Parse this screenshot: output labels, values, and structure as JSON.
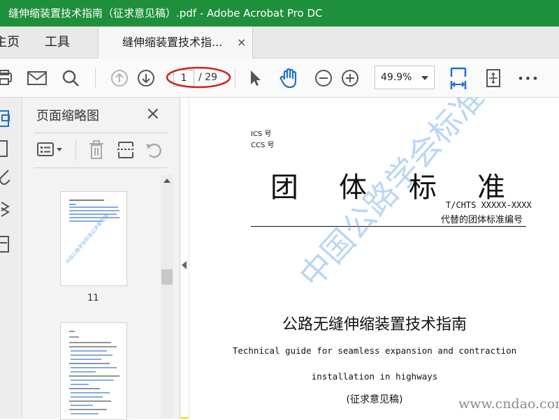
{
  "window": {
    "title": "缝伸缩装置技术指南（征求意见稿）.pdf - Adobe Acrobat Pro DC"
  },
  "nav": {
    "home": "主页",
    "tools": "工具"
  },
  "doc_tab": {
    "label": "缝伸缩装置技术指...",
    "close": "×"
  },
  "help": "?",
  "toolbar": {
    "page_current": "1",
    "page_total": "/ 29",
    "zoom": "49.9%",
    "more": "•••",
    "icons": [
      "print-icon",
      "mail-icon",
      "search-icon",
      "page-up-icon",
      "page-down-icon",
      "select-cursor-icon",
      "hand-icon",
      "zoom-out-icon",
      "zoom-in-icon",
      "fit-width-icon",
      "scroll-mode-icon",
      "more-icon"
    ],
    "highlight_color": "#d61f1f"
  },
  "thumb_panel": {
    "title": "页面缩略图",
    "close": "×",
    "pages": [
      {
        "label": "11"
      }
    ]
  },
  "document": {
    "ics": "ICS 号",
    "ccs": "CCS 号",
    "big_chars": [
      "团",
      "体",
      "标",
      "准"
    ],
    "code": "T/CHTS XXXXX-XXXX",
    "replace": "代替的团体标准编号",
    "title_cn": "公路无缝伸缩装置技术指南",
    "title_en_1": "Technical guide for seamless expansion and contraction",
    "title_en_2": "installation in highways",
    "draft_note": "(征求意见稿)"
  },
  "watermark": {
    "text": "中国公路学会标准征求意见稿",
    "color": "#6aa8e6"
  },
  "site_watermark": "www.cndao.com",
  "colors": {
    "titlebar": "#1e8f3a",
    "frame": "#f2e300",
    "accent_blue": "#1f6fd1"
  }
}
